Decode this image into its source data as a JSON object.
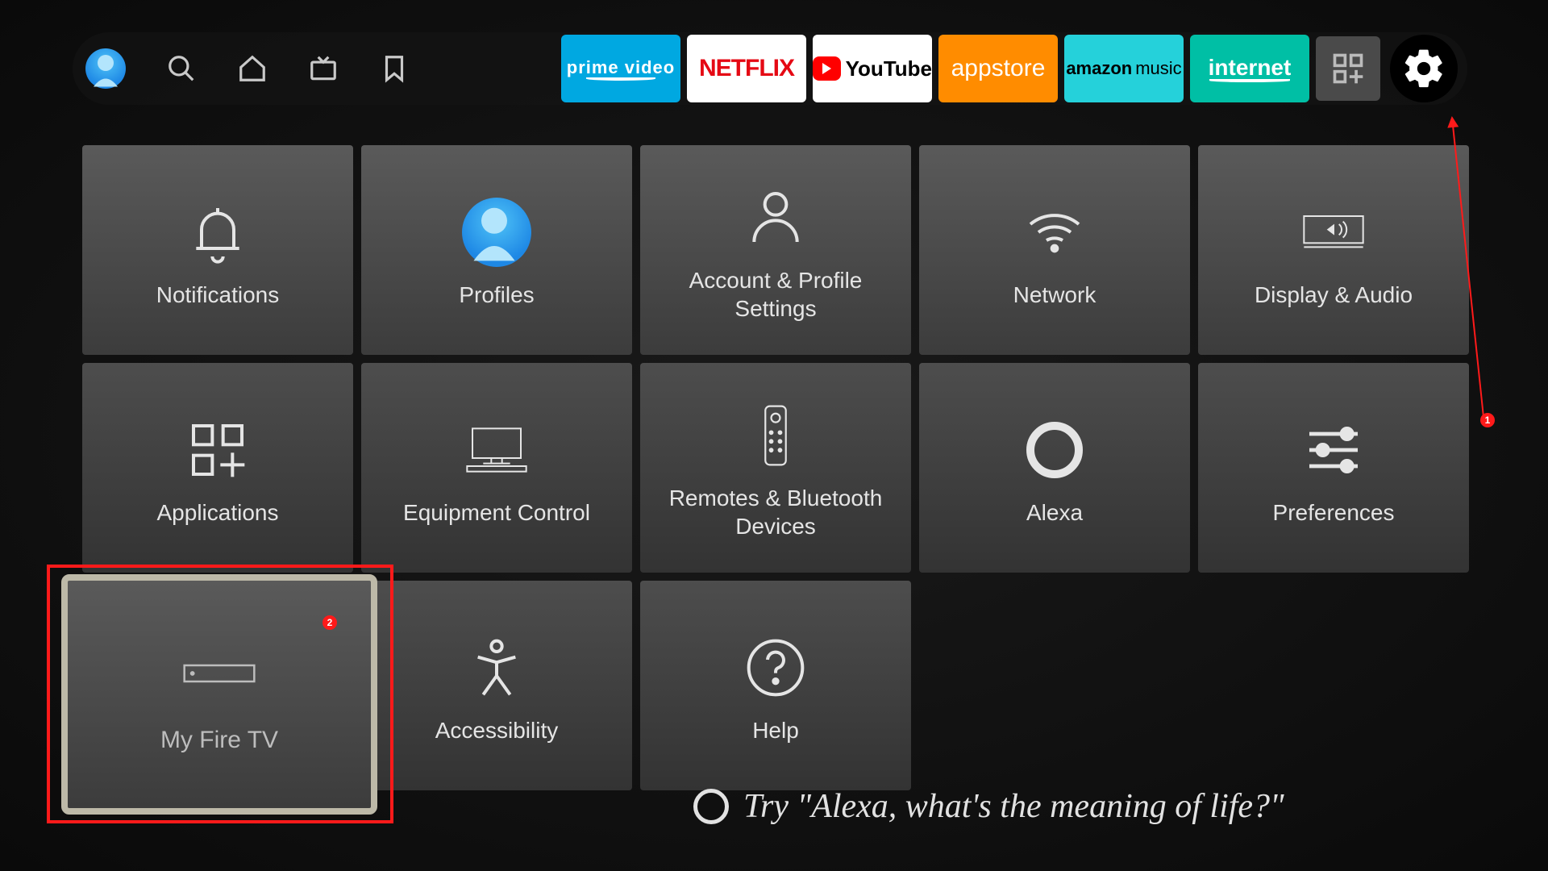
{
  "topbar": {
    "profile": "default",
    "nav_icons": {
      "search": "search-icon",
      "home": "home-icon",
      "tv": "tv-icon",
      "bookmark": "bookmark-icon"
    },
    "apps": {
      "prime_video": "prime video",
      "netflix": "NETFLIX",
      "youtube": "YouTube",
      "appstore": "appstore",
      "amazon_music_left": "amazon",
      "amazon_music_right": "music",
      "internet": "internet",
      "apps_grid": "apps-grid",
      "settings": "settings"
    }
  },
  "settings": {
    "tiles": {
      "notifications": "Notifications",
      "profiles": "Profiles",
      "account": "Account & Profile Settings",
      "network": "Network",
      "display_audio": "Display & Audio",
      "applications": "Applications",
      "equipment": "Equipment Control",
      "remotes": "Remotes & Bluetooth Devices",
      "alexa": "Alexa",
      "preferences": "Preferences",
      "my_fire_tv": "My Fire TV",
      "accessibility": "Accessibility",
      "help": "Help"
    }
  },
  "alexa_hint": "Try \"Alexa, what's the meaning of life?\"",
  "annotations": {
    "marker1": "1",
    "marker2": "2"
  }
}
